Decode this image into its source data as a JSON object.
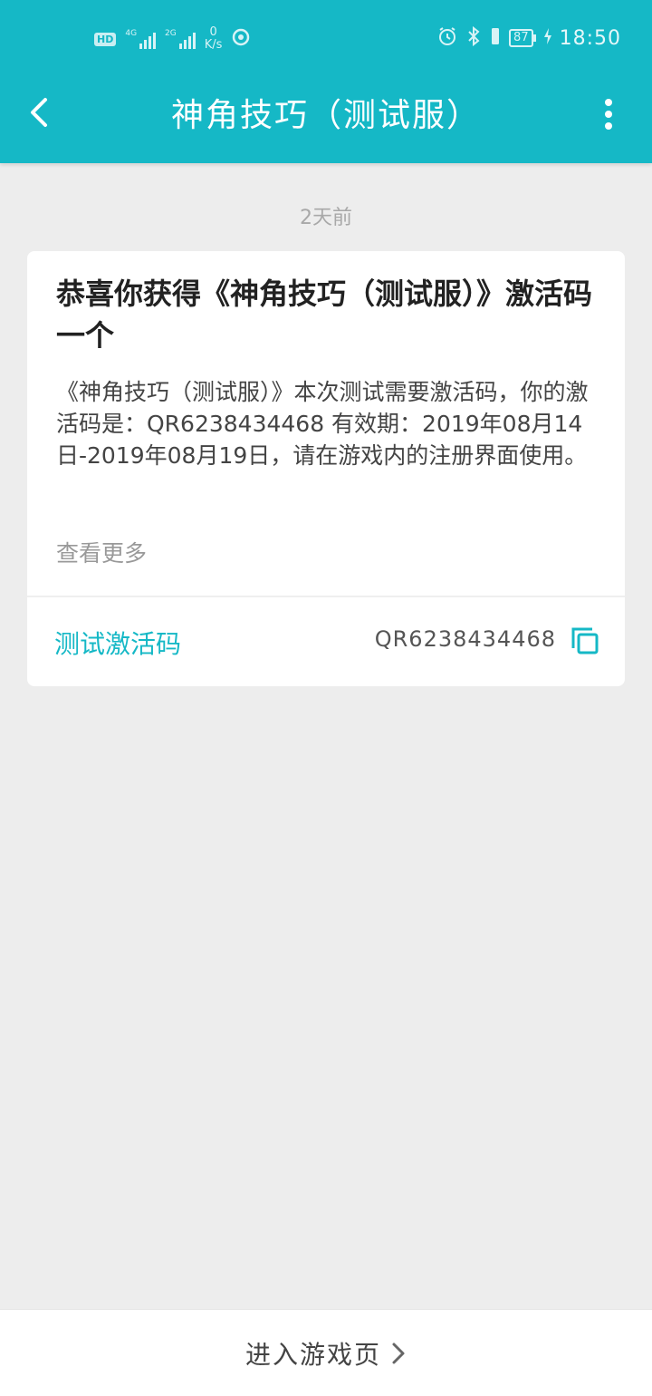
{
  "status_bar": {
    "hd": "HD",
    "sim1_label": "4G",
    "sim2_label": "2G",
    "net_speed_value": "0",
    "net_speed_unit": "K/s",
    "battery": "87",
    "time": "18:50"
  },
  "app_bar": {
    "title": "神角技巧（测试服）"
  },
  "message": {
    "time_ago": "2天前",
    "title": "恭喜你获得《神角技巧（测试服）》激活码一个",
    "body": "《神角技巧（测试服）》本次测试需要激活码，你的激活码是：QR6238434468 有效期：2019年08月14日-2019年08月19日，请在游戏内的注册界面使用。",
    "see_more": "查看更多",
    "code_label": "测试激活码",
    "code_value": "QR6238434468"
  },
  "bottom": {
    "enter_game": "进入游戏页"
  },
  "colors": {
    "accent": "#15b8c6",
    "background": "#ededed"
  }
}
